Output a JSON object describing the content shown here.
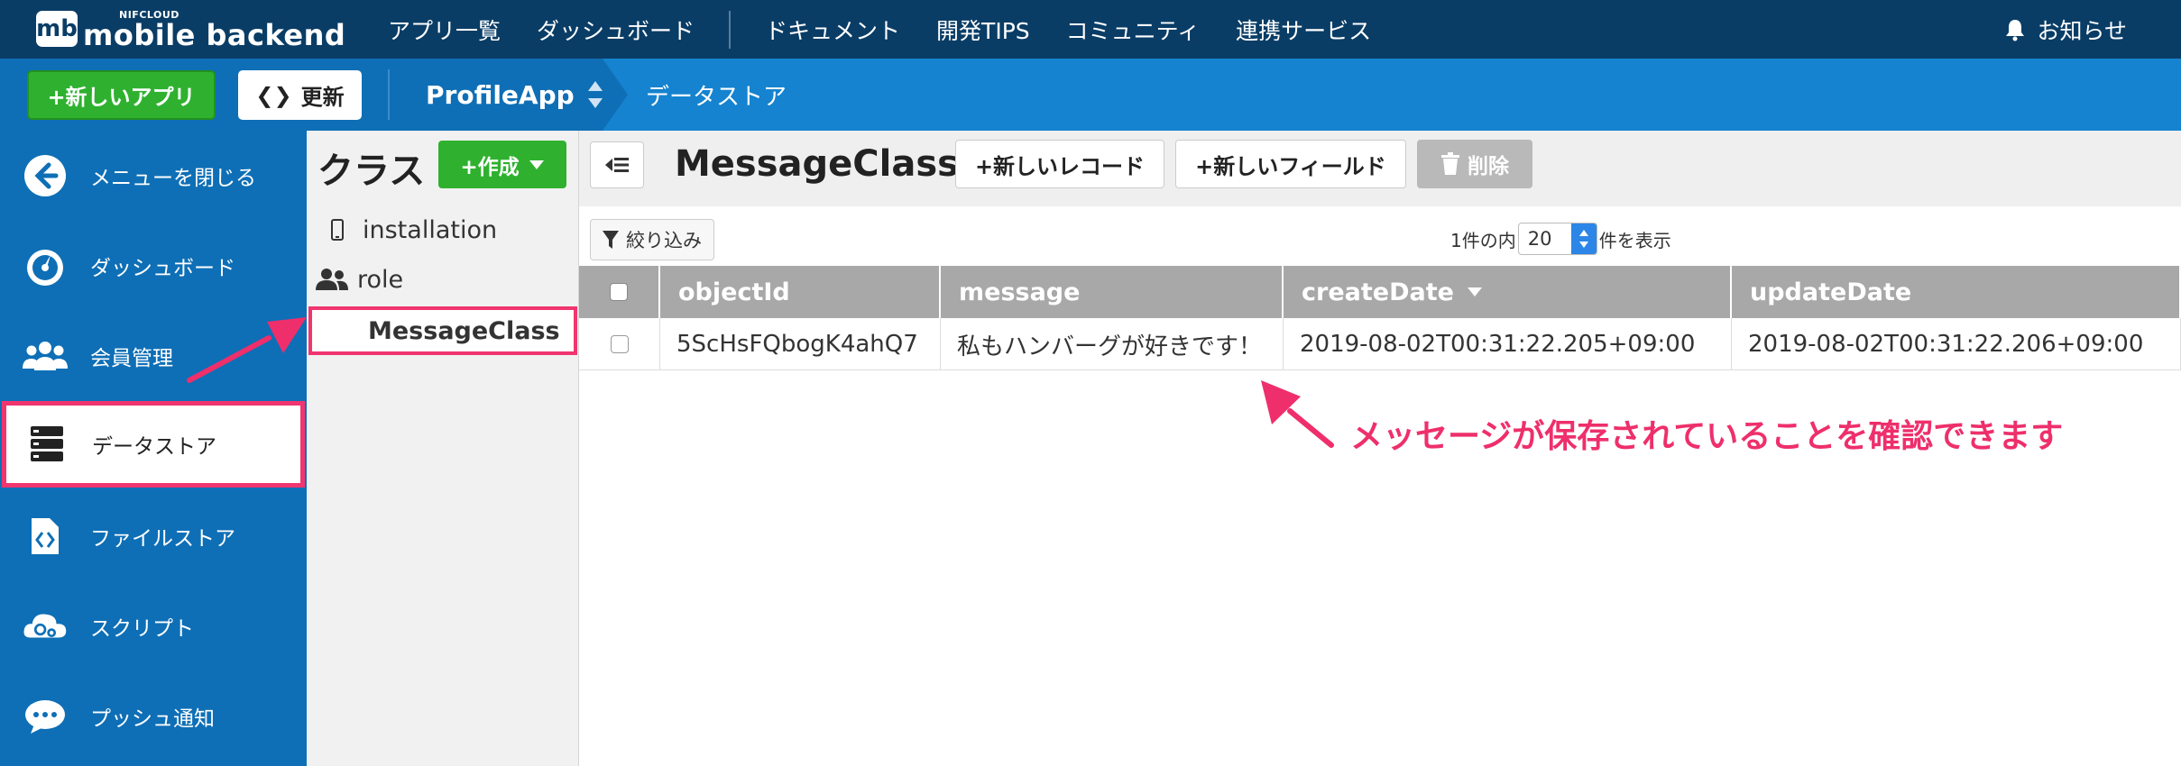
{
  "topnav": {
    "logo_small": "NIFCLOUD",
    "logo_mark": "mb",
    "logo_text": "mobile backend",
    "links": [
      "アプリ一覧",
      "ダッシュボード",
      "ドキュメント",
      "開発TIPS",
      "コミュニティ",
      "連携サービス"
    ],
    "notice": "お知らせ"
  },
  "secondbar": {
    "new_app": "+新しいアプリ",
    "refresh": "更新",
    "app_name": "ProfileApp",
    "breadcrumb": "データストア"
  },
  "sidebar": {
    "items": [
      {
        "label": "メニューを閉じる",
        "icon": "back-arrow-icon"
      },
      {
        "label": "ダッシュボード",
        "icon": "dashboard-gauge-icon"
      },
      {
        "label": "会員管理",
        "icon": "users-icon"
      },
      {
        "label": "データストア",
        "icon": "database-icon"
      },
      {
        "label": "ファイルストア",
        "icon": "file-code-icon"
      },
      {
        "label": "スクリプト",
        "icon": "cloud-gear-icon"
      },
      {
        "label": "プッシュ通知",
        "icon": "chat-bubble-icon"
      }
    ],
    "active_index": 3
  },
  "classes": {
    "title": "クラス",
    "create": "+作成",
    "items": [
      {
        "label": "installation",
        "icon": "mobile-icon"
      },
      {
        "label": "role",
        "icon": "users-icon"
      },
      {
        "label": "MessageClass",
        "icon": ""
      }
    ],
    "active_index": 2
  },
  "main": {
    "class_name": "MessageClass",
    "new_record": "+新しいレコード",
    "new_field": "+新しいフィールド",
    "delete": "削除",
    "filter": "絞り込み",
    "pagination": {
      "prefix": "1件の内",
      "per_page": "20",
      "suffix": "件を表示"
    }
  },
  "table": {
    "columns": [
      "objectId",
      "message",
      "createDate",
      "updateDate"
    ],
    "rows": [
      [
        "5ScHsFQbogK4ahQ7",
        "私もハンバーグが好きです！",
        "2019-08-02T00:31:22.205+09:00",
        "2019-08-02T00:31:22.206+09:00"
      ]
    ]
  },
  "annotation": {
    "text": "メッセージが保存されていることを確認できます",
    "color": "#ee2f6b"
  },
  "colors": {
    "topnav": "#0a3d66",
    "primary": "#0e6fb6",
    "green": "#2fb12f",
    "highlight": "#f0356f",
    "table_header": "#a8a8a8"
  }
}
